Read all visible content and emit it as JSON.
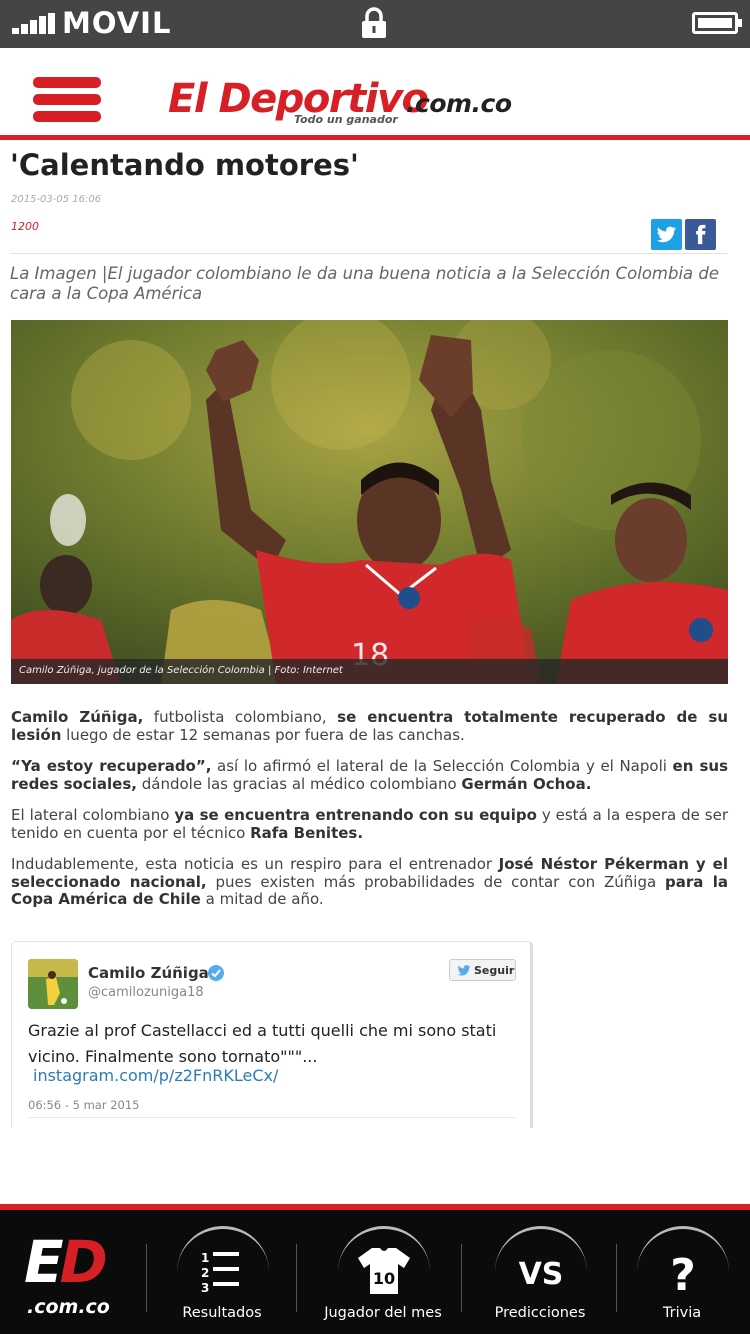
{
  "status_bar": {
    "carrier": "MOVIL",
    "icons": [
      "signal-icon",
      "lock-icon",
      "battery-icon"
    ]
  },
  "header": {
    "logo_main": "El Deportivo",
    "logo_domain": ".com.co",
    "logo_slogan": "Todo un ganador",
    "menu_icon": "hamburger-menu-icon"
  },
  "article": {
    "title": "'Calentando motores'",
    "date": "2015-03-05 16:06",
    "views": "1200",
    "share": {
      "twitter_icon": "twitter-icon",
      "facebook_icon": "facebook-icon"
    },
    "subtitle": "La Imagen |El jugador colombiano le da una buena noticia a la Selección Colombia de cara a la Copa América",
    "photo_caption": "Camilo Zúñiga, jugador de la Selección Colombia | Foto: Internet",
    "paragraphs": [
      [
        {
          "t": "Camilo Zúñiga,",
          "b": true
        },
        {
          "t": " futbolista colombiano, ",
          "b": false
        },
        {
          "t": "se encuentra totalmente recuperado de su lesión",
          "b": true
        },
        {
          "t": " luego de estar 12 semanas por fuera de las canchas.",
          "b": false
        }
      ],
      [
        {
          "t": "“Ya estoy recuperado”,",
          "b": true
        },
        {
          "t": " así lo afirmó el lateral de la Selección Colombia y el Napoli ",
          "b": false
        },
        {
          "t": "en sus redes sociales,",
          "b": true
        },
        {
          "t": " dándole las gracias al médico colombiano ",
          "b": false
        },
        {
          "t": "Germán Ochoa.",
          "b": true
        }
      ],
      [
        {
          "t": "El lateral colombiano ",
          "b": false
        },
        {
          "t": "ya se encuentra entrenando con su equipo",
          "b": true
        },
        {
          "t": " y está a la espera de ser tenido en cuenta por el técnico ",
          "b": false
        },
        {
          "t": "Rafa Benites.",
          "b": true
        }
      ],
      [
        {
          "t": "Indudablemente, esta noticia es un respiro para el entrenador ",
          "b": false
        },
        {
          "t": "José Néstor Pékerman y el seleccionado nacional,",
          "b": true
        },
        {
          "t": " pues existen más probabilidades de contar con Zúñiga ",
          "b": false
        },
        {
          "t": "para la Copa América de Chile",
          "b": true
        },
        {
          "t": " a mitad de año.",
          "b": false
        }
      ]
    ]
  },
  "tweet": {
    "name": "Camilo Zúñiga",
    "handle": "@camilozuniga18",
    "follow_label": "Seguir",
    "text": "Grazie al prof Castellacci ed a tutti quelli che mi sono stati vicino. Finalmente sono tornato\"\"\"...",
    "link": "instagram.com/p/z2FnRKLeCx/",
    "time": "06:56 - 5 mar 2015"
  },
  "bottom_nav": {
    "logo_letters": "ED",
    "logo_domain": ".com.co",
    "items": [
      {
        "label": "Resultados",
        "icon": "ranked-list-icon",
        "icon_text": "1 2 3"
      },
      {
        "label": "Jugador del mes",
        "icon": "jersey-icon",
        "icon_text": "10"
      },
      {
        "label": "Predicciones",
        "icon": "versus-icon",
        "icon_text": "VS"
      },
      {
        "label": "Trivia",
        "icon": "question-icon",
        "icon_text": "?"
      }
    ]
  },
  "colors": {
    "brand_red": "#d71f26",
    "status_bar": "#454545",
    "nav_bg": "#0b0b0b",
    "twitter_blue": "#1fa0e6",
    "facebook_blue": "#3b5998"
  }
}
